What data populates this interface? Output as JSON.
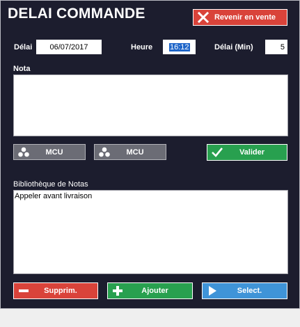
{
  "window": {
    "title": "DELAI COMMANDE"
  },
  "buttons": {
    "back": "Revenir en vente",
    "mcu1": "MCU",
    "mcu2": "MCU",
    "validate": "Valider",
    "delete": "Supprim.",
    "add": "Ajouter",
    "select": "Select."
  },
  "form": {
    "delai_label": "Délai",
    "delai_value": "06/07/2017",
    "heure_label": "Heure",
    "heure_value": "16:12",
    "delai_min_label": "Délai (Min)",
    "delai_min_value": "5",
    "nota_label": "Nota",
    "nota_value": ""
  },
  "library": {
    "label": "Bibliothèque de Notas",
    "items": [
      "Appeler avant livraison"
    ]
  },
  "colors": {
    "background": "#1c1d2e",
    "red": "#d9433a",
    "green": "#28a04f",
    "blue": "#3f94d8",
    "gray": "#6b6c75",
    "selection": "#1f66c9"
  }
}
